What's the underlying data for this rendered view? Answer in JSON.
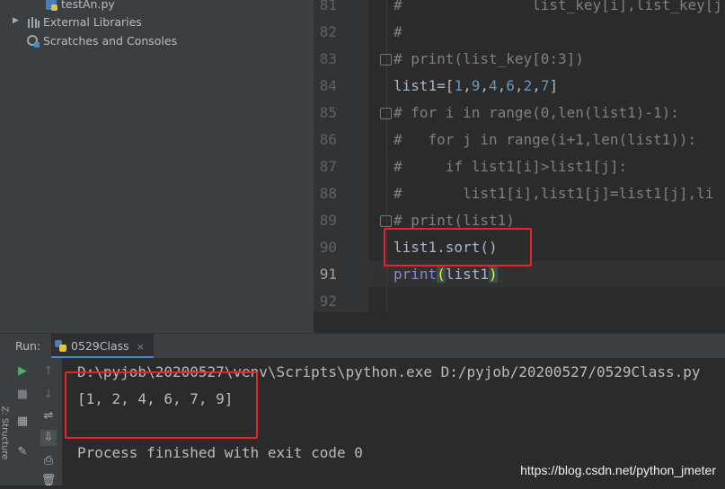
{
  "project": {
    "items": [
      {
        "label": "testAn.py"
      },
      {
        "label": "External Libraries"
      },
      {
        "label": "Scratches and Consoles"
      }
    ]
  },
  "editor": {
    "lines": [
      {
        "num": "81",
        "text": "#               list_key[i],list_key[j"
      },
      {
        "num": "82",
        "text": "#"
      },
      {
        "num": "83",
        "text": "# print(list_key[0:3])"
      },
      {
        "num": "84",
        "text_parts": [
          "list1",
          "=[",
          "1",
          ",",
          "9",
          ",",
          "4",
          ",",
          "6",
          ",",
          "2",
          ",",
          "7",
          "]"
        ]
      },
      {
        "num": "85",
        "text": "# for i in range(0,len(list1)-1):"
      },
      {
        "num": "86",
        "text": "#   for j in range(i+1,len(list1)):"
      },
      {
        "num": "87",
        "text": "#     if list1[i]>list1[j]:"
      },
      {
        "num": "88",
        "text": "#       list1[i],list1[j]=list1[j],li"
      },
      {
        "num": "89",
        "text": "# print(list1)"
      },
      {
        "num": "90",
        "text": "list1.sort()"
      },
      {
        "num": "91",
        "text_parts": [
          "print",
          "(",
          "list1",
          ")"
        ]
      },
      {
        "num": "92",
        "text": ""
      }
    ],
    "current_line": "91"
  },
  "run": {
    "label": "Run:",
    "tab": "0529Class",
    "close": "×",
    "side_label": "Z: Structure"
  },
  "console": {
    "command": "D:\\pyjob\\20200527\\venv\\Scripts\\python.exe D:/pyjob/20200527/0529Class.py",
    "output": "[1, 2, 4, 6, 7, 9]",
    "exit": "Process finished with exit code 0"
  },
  "watermark": "https://blog.csdn.net/python_jmeter",
  "colors": {
    "highlight_box": "#e8232a",
    "comment": "#808080",
    "number": "#6897bb",
    "keyword": "#cc7832"
  }
}
